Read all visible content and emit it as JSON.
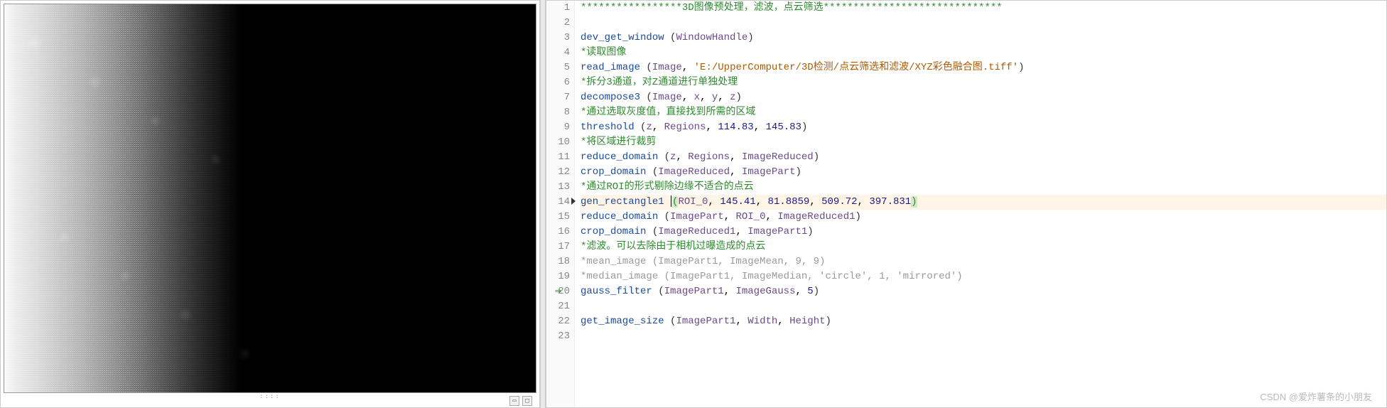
{
  "watermark": "CSDN @爱炸薯条的小朋友",
  "current_line": 14,
  "exec_line": 20,
  "code": {
    "lines": [
      {
        "n": 1,
        "type": "comment",
        "text": "*****************3D图像预处理，滤波，点云筛选******************************"
      },
      {
        "n": 2,
        "type": "blank",
        "text": ""
      },
      {
        "n": 3,
        "type": "call",
        "func": "dev_get_window",
        "args": " (WindowHandle)"
      },
      {
        "n": 4,
        "type": "comment",
        "text": "*读取图像"
      },
      {
        "n": 5,
        "type": "call",
        "func": "read_image",
        "args": " (Image, 'E:/UpperComputer/3D检测/点云筛选和滤波/XYZ彩色融合图.tiff')"
      },
      {
        "n": 6,
        "type": "comment",
        "text": "*拆分3通道，对Z通道进行单独处理"
      },
      {
        "n": 7,
        "type": "call",
        "func": "decompose3",
        "args": " (Image, x, y, z)"
      },
      {
        "n": 8,
        "type": "comment",
        "text": "*通过选取灰度值，直接找到所需的区域"
      },
      {
        "n": 9,
        "type": "call",
        "func": "threshold",
        "args": " (z, Regions, 114.83, 145.83)"
      },
      {
        "n": 10,
        "type": "comment",
        "text": "*将区域进行裁剪"
      },
      {
        "n": 11,
        "type": "call",
        "func": "reduce_domain",
        "args": " (z, Regions, ImageReduced)"
      },
      {
        "n": 12,
        "type": "call",
        "func": "crop_domain",
        "args": " (ImageReduced, ImagePart)"
      },
      {
        "n": 13,
        "type": "comment",
        "text": "*通过ROI的形式剔除边缘不适合的点云"
      },
      {
        "n": 14,
        "type": "call-current",
        "func": "gen_rectangle1",
        "args_pre": " ",
        "args_open": "(",
        "args_mid": "ROI_0, 145.41, 81.8859, 509.72, 397.831",
        "args_close": ")"
      },
      {
        "n": 15,
        "type": "call",
        "func": "reduce_domain",
        "args": " (ImagePart, ROI_0, ImageReduced1)"
      },
      {
        "n": 16,
        "type": "call",
        "func": "crop_domain",
        "args": " (ImageReduced1, ImagePart1)"
      },
      {
        "n": 17,
        "type": "comment",
        "text": "*滤波。可以去除由于相机过曝造成的点云"
      },
      {
        "n": 18,
        "type": "disabled",
        "text": "*mean_image (ImagePart1, ImageMean, 9, 9)"
      },
      {
        "n": 19,
        "type": "disabled",
        "text": "*median_image (ImagePart1, ImageMedian, 'circle', 1, 'mirrored')"
      },
      {
        "n": 20,
        "type": "call-exec",
        "func": "gauss_filter",
        "args": " (ImagePart1, ImageGauss, 5)"
      },
      {
        "n": 21,
        "type": "blank",
        "text": ""
      },
      {
        "n": 22,
        "type": "call",
        "func": "get_image_size",
        "args": " (ImagePart1, Width, Height)"
      },
      {
        "n": 23,
        "type": "blank",
        "text": ""
      }
    ]
  }
}
